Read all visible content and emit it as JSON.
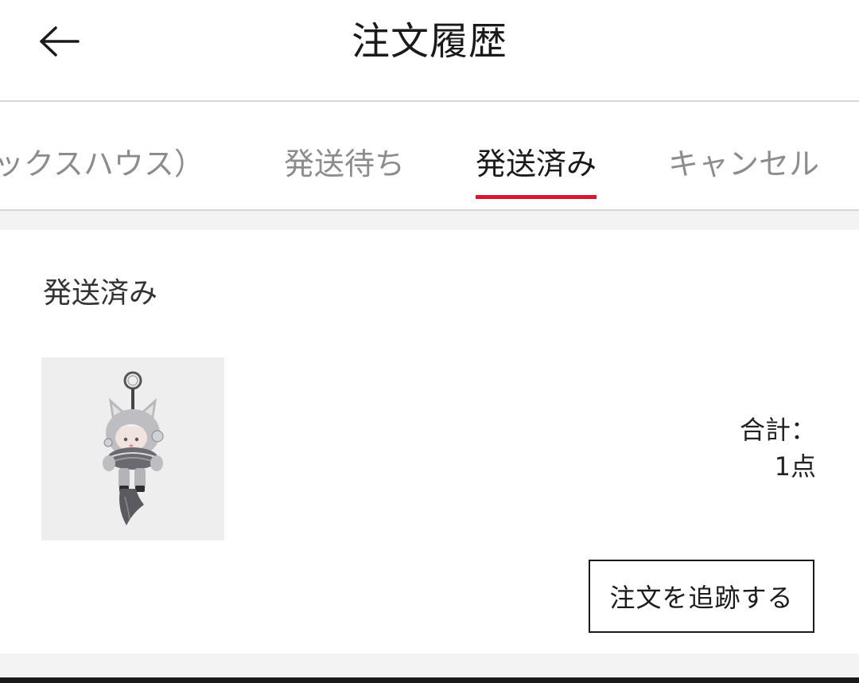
{
  "header": {
    "title": "注文履歴",
    "back_icon": "arrow-left-icon"
  },
  "tabs": [
    {
      "label": "ックスハウス）",
      "active": false
    },
    {
      "label": "発送待ち",
      "active": false
    },
    {
      "label": "発送済み",
      "active": true
    },
    {
      "label": "キャンセル",
      "active": false
    }
  ],
  "colors": {
    "accent": "#d8182f",
    "tab_inactive": "#8c8c8c",
    "separator": "#f3f3f3"
  },
  "order": {
    "status": "発送済み",
    "product_image": "keychain-figure-image",
    "total_label": "合計：",
    "total_count": "1点",
    "track_button_label": "注文を追跡する"
  }
}
